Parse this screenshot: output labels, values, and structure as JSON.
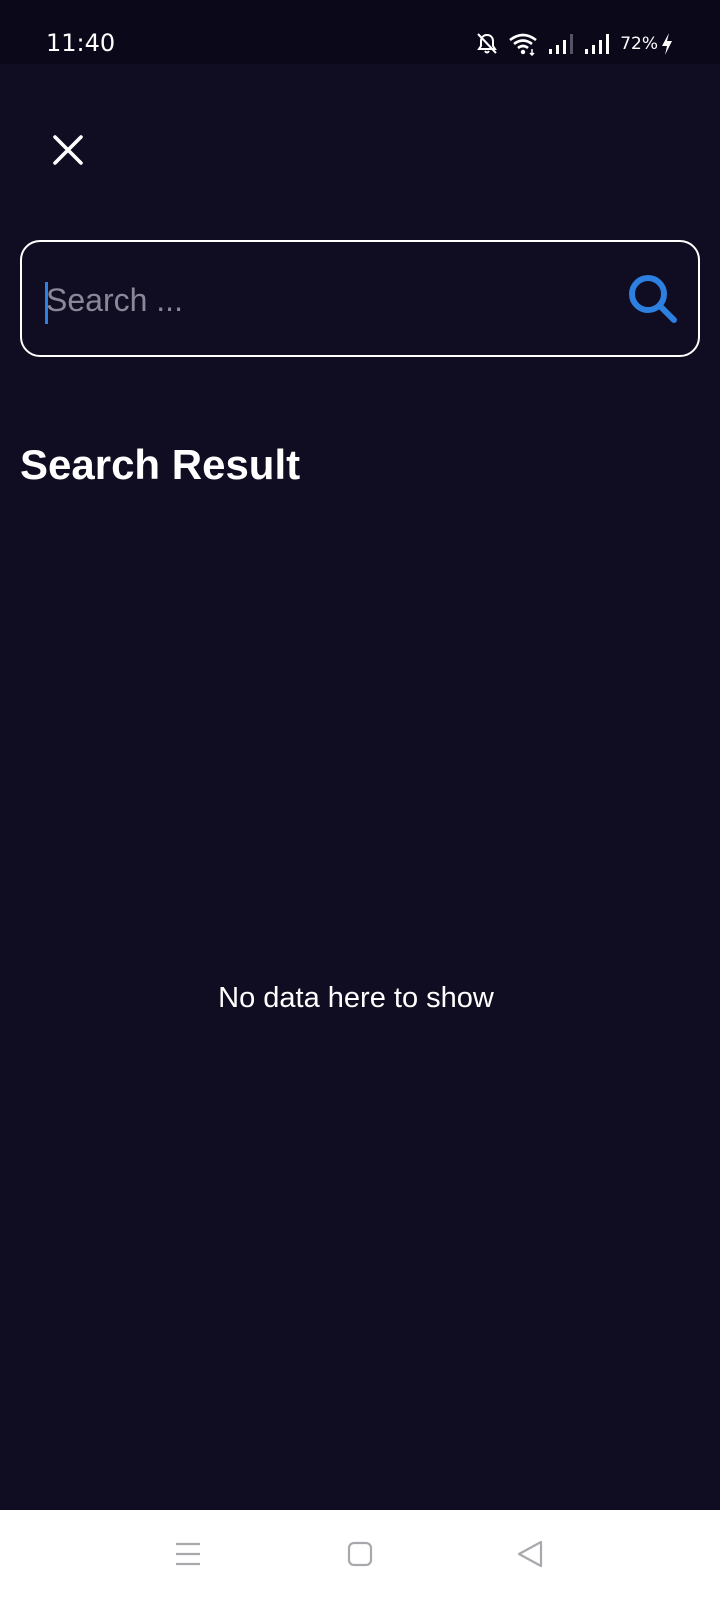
{
  "status_bar": {
    "time": "11:40",
    "battery": "72%",
    "icons": [
      "bell-off-icon",
      "wifi-icon",
      "signal-icon",
      "signal-icon",
      "charging-icon"
    ]
  },
  "header": {
    "close_icon": "close-icon"
  },
  "search": {
    "placeholder": "Search ...",
    "value": "",
    "icon": "search-icon",
    "accent_color": "#2d7fe0"
  },
  "results": {
    "title": "Search Result",
    "empty_message": "No data here to show"
  },
  "nav_bar": {
    "icons": [
      "menu-icon",
      "home-icon",
      "back-icon"
    ]
  },
  "colors": {
    "background": "#100d22",
    "status_bar": "#0b0919",
    "accent": "#2d7fe0"
  }
}
